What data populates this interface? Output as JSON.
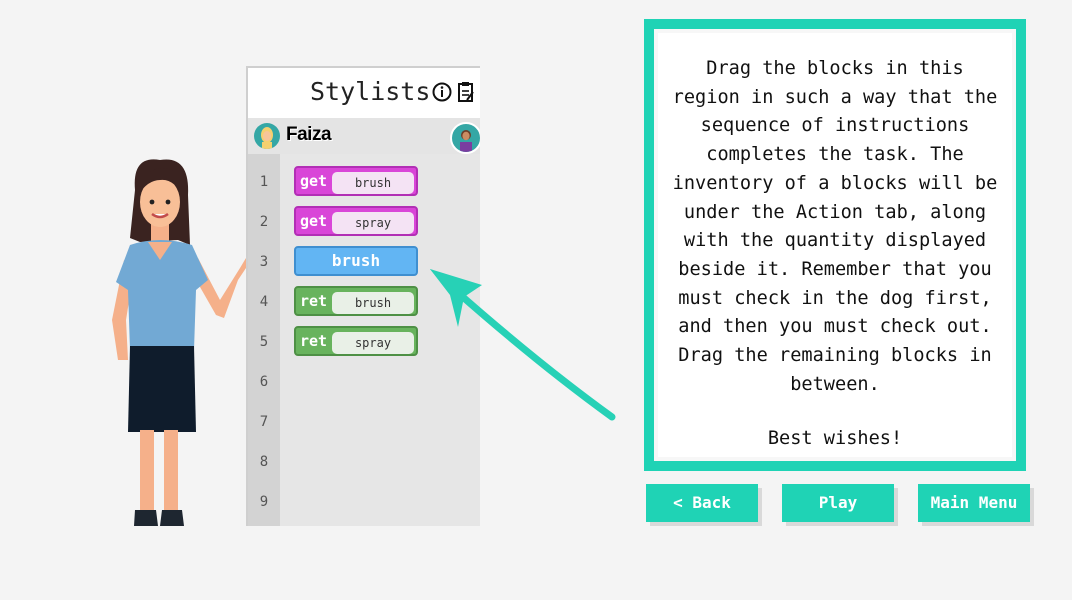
{
  "panel": {
    "title": "Stylists",
    "title_icons": [
      "info-icon",
      "notes-icon"
    ],
    "user_name": "Faiza",
    "line_numbers": [
      "1",
      "2",
      "3",
      "4",
      "5",
      "6",
      "7",
      "8",
      "9"
    ],
    "blocks": [
      {
        "type": "get",
        "keyword": "get",
        "argument": "brush"
      },
      {
        "type": "get",
        "keyword": "get",
        "argument": "spray"
      },
      {
        "type": "action",
        "label": "brush"
      },
      {
        "type": "ret",
        "keyword": "ret",
        "argument": "brush"
      },
      {
        "type": "ret",
        "keyword": "ret",
        "argument": "spray"
      }
    ]
  },
  "instructions": {
    "body": "Drag the blocks in this region in such a way that the sequence of instructions completes the task. The inventory of a blocks will be under the Action tab, along with the quantity displayed beside it. Remember that you must check in the dog first, and then you must check out. Drag the remaining blocks in between.",
    "closing": "Best wishes!"
  },
  "buttons": {
    "back": "< Back",
    "play": "Play",
    "main_menu": "Main Menu"
  },
  "colors": {
    "accent": "#1fd3b5",
    "get_block": "#d946d8",
    "ret_block": "#68b35d",
    "action_block": "#62b5f3"
  }
}
